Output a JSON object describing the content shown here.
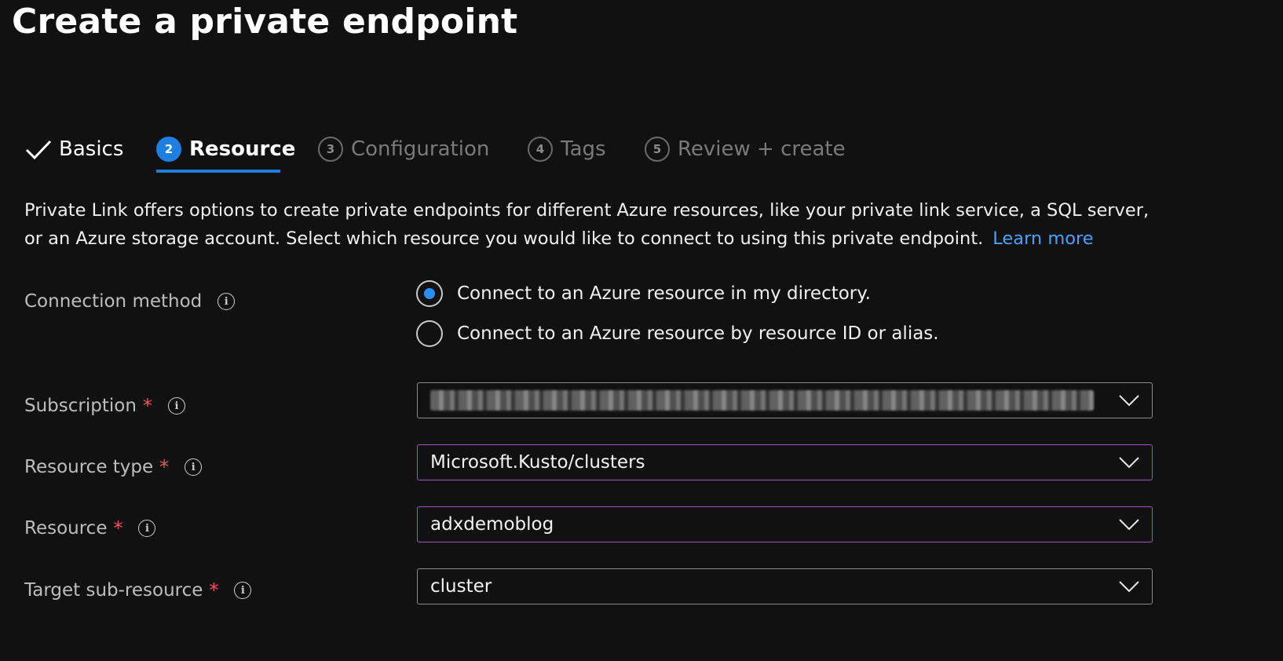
{
  "page": {
    "title": "Create a private endpoint",
    "more_label": "···"
  },
  "tabs": [
    {
      "label": "Basics",
      "state": "done"
    },
    {
      "num": "2",
      "label": "Resource",
      "state": "active"
    },
    {
      "num": "3",
      "label": "Configuration",
      "state": "inactive"
    },
    {
      "num": "4",
      "label": "Tags",
      "state": "inactive"
    },
    {
      "num": "5",
      "label": "Review + create",
      "state": "inactive"
    }
  ],
  "description": {
    "text": "Private Link offers options to create private endpoints for different Azure resources, like your private link service, a SQL server, or an Azure storage account. Select which resource you would like to connect to using this private endpoint.",
    "link": "Learn more"
  },
  "form": {
    "connection_method": {
      "label": "Connection method",
      "info_glyph": "i",
      "options": [
        {
          "label": "Connect to an Azure resource in my directory.",
          "selected": true
        },
        {
          "label": "Connect to an Azure resource by resource ID or alias.",
          "selected": false
        }
      ]
    },
    "subscription": {
      "label": "Subscription",
      "required_mark": "*",
      "info_glyph": "i"
    },
    "resource_type": {
      "label": "Resource type",
      "required_mark": "*",
      "info_glyph": "i",
      "value": "Microsoft.Kusto/clusters"
    },
    "resource": {
      "label": "Resource",
      "required_mark": "*",
      "info_glyph": "i",
      "value": "adxdemoblog"
    },
    "target_sub_resource": {
      "label": "Target sub-resource",
      "required_mark": "*",
      "info_glyph": "i",
      "value": "cluster"
    }
  },
  "colors": {
    "accent": "#1f7fe0",
    "focus_border": "#a24fbf",
    "required": "#f2565a",
    "link": "#4ea1ff",
    "background": "#111111"
  }
}
